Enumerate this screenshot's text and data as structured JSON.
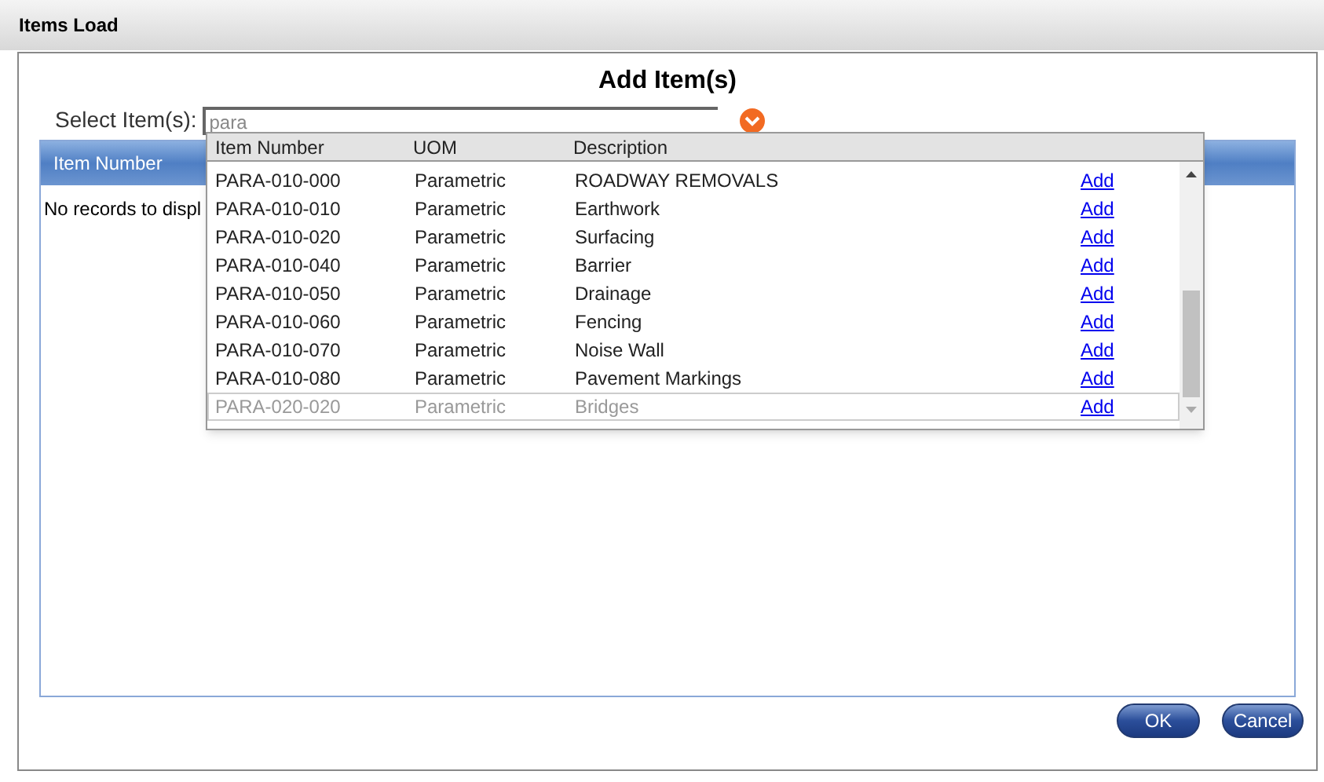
{
  "window": {
    "title": "Items Load"
  },
  "dialog": {
    "heading": "Add Item(s)",
    "select_label": "Select Item(s):",
    "search": {
      "value": "para"
    }
  },
  "grid": {
    "columns": [
      "Item Number"
    ],
    "empty_text": "No records to displ"
  },
  "dropdown": {
    "columns": [
      "Item Number",
      "UOM",
      "Description"
    ],
    "rows": [
      {
        "item_number": "PARA-010-000",
        "uom": "Parametric",
        "description": "ROADWAY REMOVALS",
        "action": "Add",
        "disabled": false
      },
      {
        "item_number": "PARA-010-010",
        "uom": "Parametric",
        "description": "Earthwork",
        "action": "Add",
        "disabled": false
      },
      {
        "item_number": "PARA-010-020",
        "uom": "Parametric",
        "description": "Surfacing",
        "action": "Add",
        "disabled": false
      },
      {
        "item_number": "PARA-010-040",
        "uom": "Parametric",
        "description": "Barrier",
        "action": "Add",
        "disabled": false
      },
      {
        "item_number": "PARA-010-050",
        "uom": "Parametric",
        "description": "Drainage",
        "action": "Add",
        "disabled": false
      },
      {
        "item_number": "PARA-010-060",
        "uom": "Parametric",
        "description": "Fencing",
        "action": "Add",
        "disabled": false
      },
      {
        "item_number": "PARA-010-070",
        "uom": "Parametric",
        "description": "Noise Wall",
        "action": "Add",
        "disabled": false
      },
      {
        "item_number": "PARA-010-080",
        "uom": "Parametric",
        "description": "Pavement Markings",
        "action": "Add",
        "disabled": false
      },
      {
        "item_number": "PARA-020-020",
        "uom": "Parametric",
        "description": "Bridges",
        "action": "Add",
        "disabled": true
      }
    ]
  },
  "buttons": [
    "OK",
    "Cancel"
  ]
}
